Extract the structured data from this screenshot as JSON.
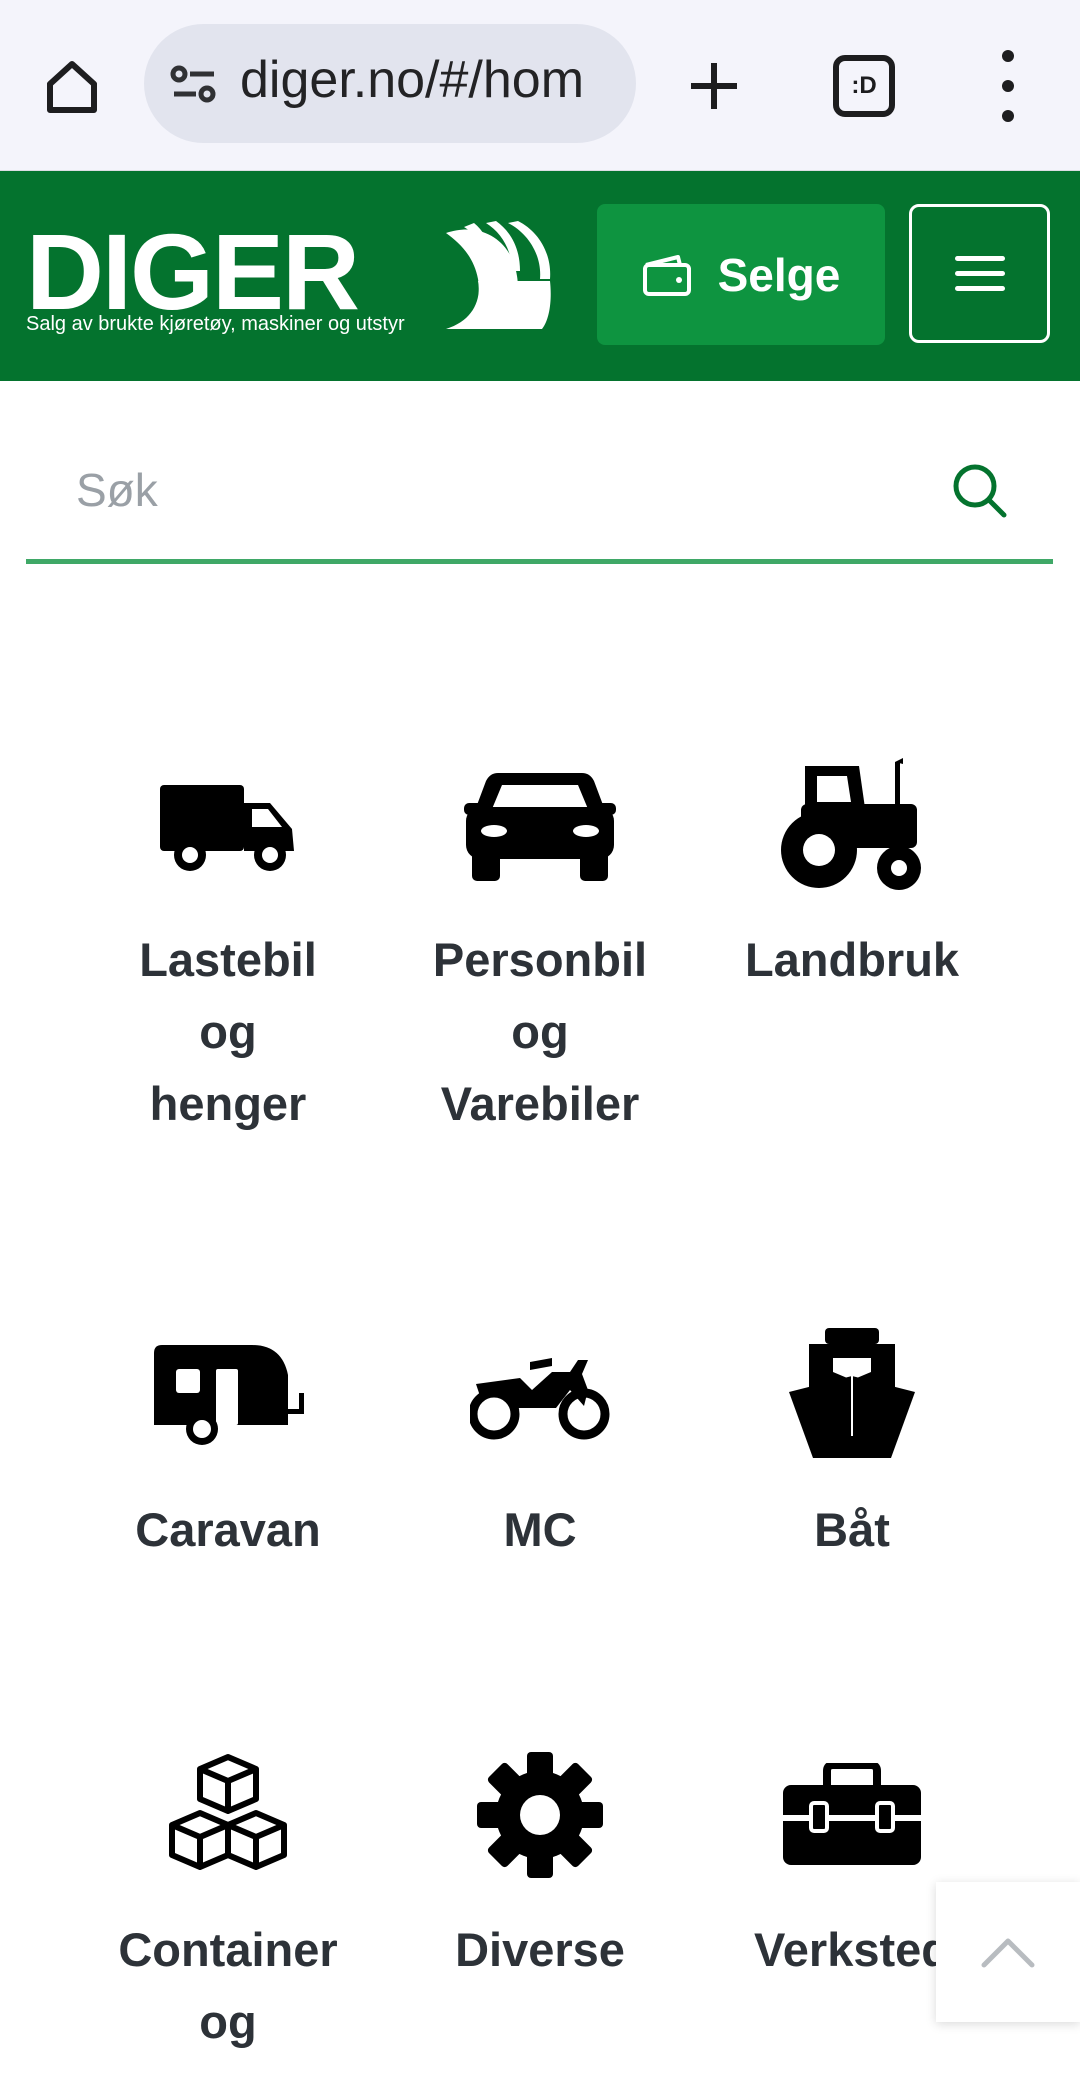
{
  "browser": {
    "url": "diger.no/#/hom",
    "tabs_count": ":D"
  },
  "header": {
    "logo_text": "DIGER",
    "tagline": "Salg av brukte kjøretøy, maskiner og utstyr",
    "sell_label": "Selge"
  },
  "search": {
    "placeholder": "Søk"
  },
  "categories": [
    {
      "label": "Lastebil og henger",
      "icon": "truck-icon"
    },
    {
      "label": "Personbil og Varebiler",
      "icon": "car-icon"
    },
    {
      "label": "Landbruk",
      "icon": "tractor-icon"
    },
    {
      "label": "Caravan",
      "icon": "caravan-icon"
    },
    {
      "label": "MC",
      "icon": "motorcycle-icon"
    },
    {
      "label": "Båt",
      "icon": "boat-icon"
    },
    {
      "label": "Container og",
      "icon": "cubes-icon"
    },
    {
      "label": "Diverse",
      "icon": "gear-icon"
    },
    {
      "label": "Verksted",
      "icon": "toolbox-icon"
    }
  ],
  "colors": {
    "brand_green": "#04732e",
    "button_green": "#0e9440",
    "search_underline": "#3fa867"
  }
}
